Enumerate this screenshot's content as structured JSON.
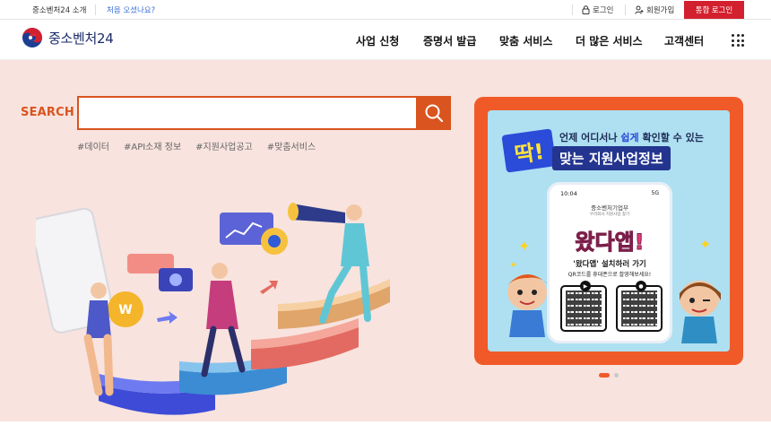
{
  "utility": {
    "about": "중소벤처24 소개",
    "first_visit": "처음 오셨나요?",
    "login": "로그인",
    "signup": "회원가입",
    "integrated_login": "통합 로그인"
  },
  "header": {
    "logo_text": "중소벤처24",
    "nav": [
      "사업 신청",
      "증명서 발급",
      "맞춤 서비스",
      "더 많은 서비스",
      "고객센터"
    ]
  },
  "search": {
    "label": "SEARCH",
    "value": "",
    "placeholder": "",
    "tags": [
      "#데이터",
      "#API소재 정보",
      "#지원사업공고",
      "#맞춤서비스"
    ]
  },
  "banner": {
    "badge": "딱!",
    "line1_pre": "언제 어디서나 ",
    "line1_hl": "쉽게",
    "line1_post": " 확인할 수 있는",
    "line2": "맞는 지원사업정보",
    "phone_time": "10:04",
    "phone_signal": "5G",
    "phone_org": "중소벤처기업부",
    "phone_sub": "우리회사 지원사업 찾기",
    "app_name": "왔다앱!",
    "install": "'왔다앱' 설치하러 가기",
    "qr_copy": "QR코드를 휴대폰으로 촬영해보세요!"
  },
  "colors": {
    "accent": "#d9541f",
    "brand_red": "#d3202e",
    "hero_bg": "#f8e3de",
    "banner_orange": "#f05a28"
  }
}
